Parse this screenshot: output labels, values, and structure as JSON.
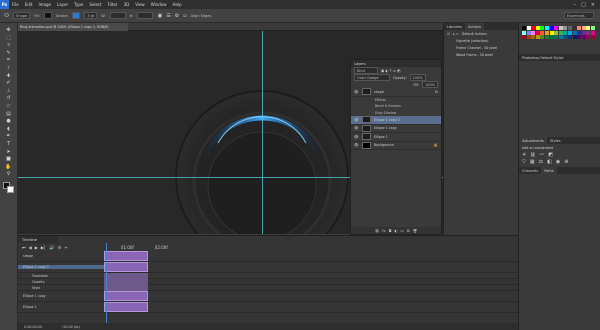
{
  "app": {
    "logo": "Ps"
  },
  "menu": [
    "File",
    "Edit",
    "Image",
    "Layer",
    "Type",
    "Select",
    "Filter",
    "3D",
    "View",
    "Window",
    "Help"
  ],
  "window_controls": [
    "–",
    "□",
    "×"
  ],
  "options_bar": {
    "tool": "Shape",
    "fill_label": "Fill:",
    "stroke_label": "Stroke:",
    "stroke_size": "3 pt",
    "w_label": "W:",
    "h_label": "H:",
    "align_edges": "Align Edges",
    "workspace": "Essentials"
  },
  "document_tab": "Ring animation.psd @ 100% (Ellipse 1 copy 2, RGB/8)",
  "tools": [
    "move-icon",
    "marquee-icon",
    "lasso-icon",
    "quick-select-icon",
    "crop-icon",
    "eyedropper-icon",
    "healing-icon",
    "brush-icon",
    "clone-icon",
    "history-brush-icon",
    "eraser-icon",
    "gradient-icon",
    "blur-icon",
    "dodge-icon",
    "pen-icon",
    "type-icon",
    "path-select-icon",
    "shape-icon",
    "hand-icon",
    "zoom-icon"
  ],
  "layers_panel": {
    "title": "Layers",
    "filter": "Kind",
    "blend_mode": "Color Dodge",
    "opacity_label": "Opacity:",
    "opacity": "100%",
    "fill_label": "Fill:",
    "fill": "100%",
    "layers": [
      {
        "name": "shape",
        "fx": true
      },
      {
        "name": "Ellipse 1 copy 2",
        "fx": false,
        "selected": true
      },
      {
        "name": "Ellipse 1 copy",
        "fx": false
      },
      {
        "name": "Ellipse 1",
        "fx": false
      },
      {
        "name": "Background",
        "fx": false
      }
    ],
    "effects_label": "Effects",
    "effects": [
      "Bevel & Emboss",
      "Drop Shadow"
    ]
  },
  "right_panels": {
    "libraries_tab": "Libraries",
    "actions_tab": "Actions",
    "actions": [
      "Default Actions",
      "Vignette (selection)",
      "Frame Channel - 50 pixel",
      "Wood Frame - 50 pixel"
    ],
    "swatch_colors": [
      "#000000",
      "#ffffff",
      "#ff0000",
      "#ffff00",
      "#00ff00",
      "#00ffff",
      "#0000ff",
      "#ff00ff",
      "#c8c8c8",
      "#969696",
      "#646464",
      "#323232",
      "#ff8080",
      "#ffb080",
      "#ffff80",
      "#80ff80",
      "#80ffff",
      "#8080ff",
      "#ff80ff",
      "#e6004a",
      "#f26522",
      "#f7941d",
      "#fff200",
      "#8dc63f",
      "#39b54a",
      "#00a99d",
      "#00aeef",
      "#0072bc",
      "#2e3192",
      "#662d91",
      "#92278f",
      "#ec008c",
      "#9e0b0f",
      "#a0410d",
      "#a36209",
      "#aba000",
      "#598527",
      "#197b30",
      "#007236",
      "#00746b",
      "#0076a3",
      "#004a80",
      "#003471",
      "#1b1464",
      "#440e62",
      "#630460",
      "#9e005d",
      "#9e0039"
    ],
    "styles_tab": "Styles",
    "adjustments_tab": "Adjustments",
    "add_adjustment": "Add an adjustment",
    "channels_tab": "Channels",
    "paths_tab": "Paths",
    "default_styles": "Photoshop Default Styles"
  },
  "timeline": {
    "title": "Timeline",
    "tracks": [
      {
        "name": "shape",
        "selected": false
      },
      {
        "name": "Ellipse 1 copy 2",
        "selected": true
      },
      {
        "name": "Transform",
        "selected": false
      },
      {
        "name": "Opacity",
        "selected": false
      },
      {
        "name": "Style",
        "selected": false
      },
      {
        "name": "Ellipse 1 copy",
        "selected": false
      },
      {
        "name": "Ellipse 1",
        "selected": false
      }
    ],
    "timecode": "0:00:00:00",
    "fps": "(30.00 fps)",
    "ruler": [
      "01:00f",
      "02:00f"
    ]
  }
}
